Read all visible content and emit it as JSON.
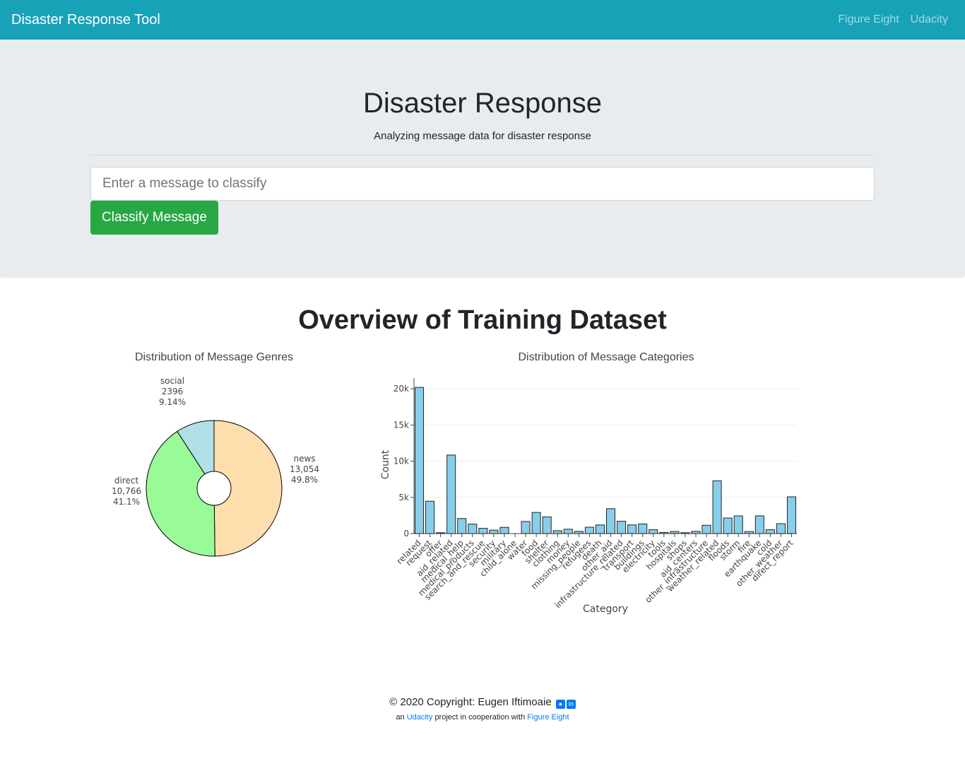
{
  "navbar": {
    "brand": "Disaster Response Tool",
    "links": [
      "Figure Eight",
      "Udacity"
    ]
  },
  "hero": {
    "title": "Disaster Response",
    "subtitle": "Analyzing message data for disaster response",
    "input_placeholder": "Enter a message to classify",
    "button_label": "Classify Message"
  },
  "overview": {
    "title": "Overview of Training Dataset"
  },
  "chart_data": [
    {
      "type": "pie",
      "title": "Distribution of Message Genres",
      "hole": true,
      "slices": [
        {
          "label": "news",
          "value": 13054,
          "display_value": "13,054",
          "percent": "49.8%",
          "color": "#ffdead"
        },
        {
          "label": "direct",
          "value": 10766,
          "display_value": "10,766",
          "percent": "41.1%",
          "color": "#98fb98"
        },
        {
          "label": "social",
          "value": 2396,
          "display_value": "2396",
          "percent": "9.14%",
          "color": "#b0e0e6"
        }
      ]
    },
    {
      "type": "bar",
      "title": "Distribution of Message Categories",
      "xlabel": "Category",
      "ylabel": "Count",
      "ylim": [
        0,
        21000
      ],
      "yticks": [
        0,
        5000,
        10000,
        15000,
        20000
      ],
      "ytick_labels": [
        "0",
        "5k",
        "10k",
        "15k",
        "20k"
      ],
      "bar_color": "#87ceeb",
      "categories": [
        "related",
        "request",
        "offer",
        "aid_related",
        "medical_help",
        "medical_products",
        "search_and_rescue",
        "security",
        "military",
        "child_alone",
        "water",
        "food",
        "shelter",
        "clothing",
        "money",
        "missing_people",
        "refugees",
        "death",
        "other_aid",
        "infrastructure_related",
        "transport",
        "buildings",
        "electricity",
        "tools",
        "hospitals",
        "shops",
        "aid_centers",
        "other_infrastructure",
        "weather_related",
        "floods",
        "storm",
        "fire",
        "earthquake",
        "cold",
        "other_weather",
        "direct_report"
      ],
      "values": [
        20200,
        4470,
        120,
        10850,
        2080,
        1310,
        720,
        470,
        860,
        0,
        1670,
        2920,
        2310,
        400,
        600,
        300,
        880,
        1190,
        3440,
        1700,
        1200,
        1330,
        530,
        160,
        280,
        120,
        310,
        1150,
        7300,
        2150,
        2440,
        280,
        2450,
        530,
        1370,
        5080
      ]
    }
  ],
  "footer": {
    "copyright": "© 2020 Copyright: Eugen Iftimoaie",
    "sub_prefix": "an",
    "sub_link1": "Udacity",
    "sub_middle": "project in cooperation with",
    "sub_link2": "Figure Eight"
  }
}
